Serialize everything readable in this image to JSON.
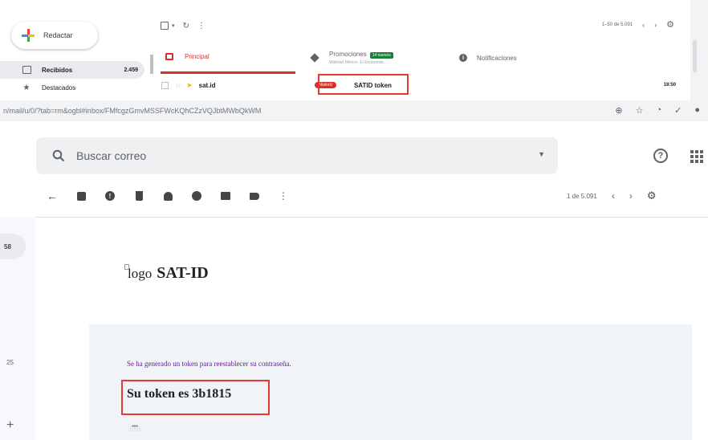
{
  "inbox": {
    "compose_label": "Redactar",
    "nav": [
      {
        "label": "Recibidos",
        "count": "2.459",
        "icon": "inbox-icon"
      },
      {
        "label": "Destacados",
        "count": "",
        "icon": "star-icon"
      }
    ],
    "pagination": "1–50 de 5.091",
    "tabs": {
      "principal": "Principal",
      "promotions": "Promociones",
      "promotions_badge": "14 nuevos",
      "promotions_sub": "Walmart México, El Economist...",
      "notifications": "Notificaciones"
    },
    "row": {
      "sender": "sat.id",
      "tag": "Nuevo",
      "subject": "SATID token",
      "time": "18:50"
    }
  },
  "message_view": {
    "url": "n/mail/u/0/?tab=rm&ogbl#inbox/FMfcgzGmvMSSFWcKQhCZzVQJbtMWbQkWM",
    "search_placeholder": "Buscar correo",
    "pagination": "1 de 5.091",
    "left_badge": "58",
    "left_count": "25",
    "logo_alt": "logo",
    "logo_text": "SAT-ID",
    "body_line": "Se ha generado un token para reestablecer su contraseña.",
    "token_line": "Su token es 3b1815",
    "ellipsis": "•••"
  },
  "colors": {
    "highlight_box": "#e53935",
    "principal_tab": "#d93025",
    "body_text": "#6a1b9a",
    "card_bg": "#f0f3f7"
  }
}
